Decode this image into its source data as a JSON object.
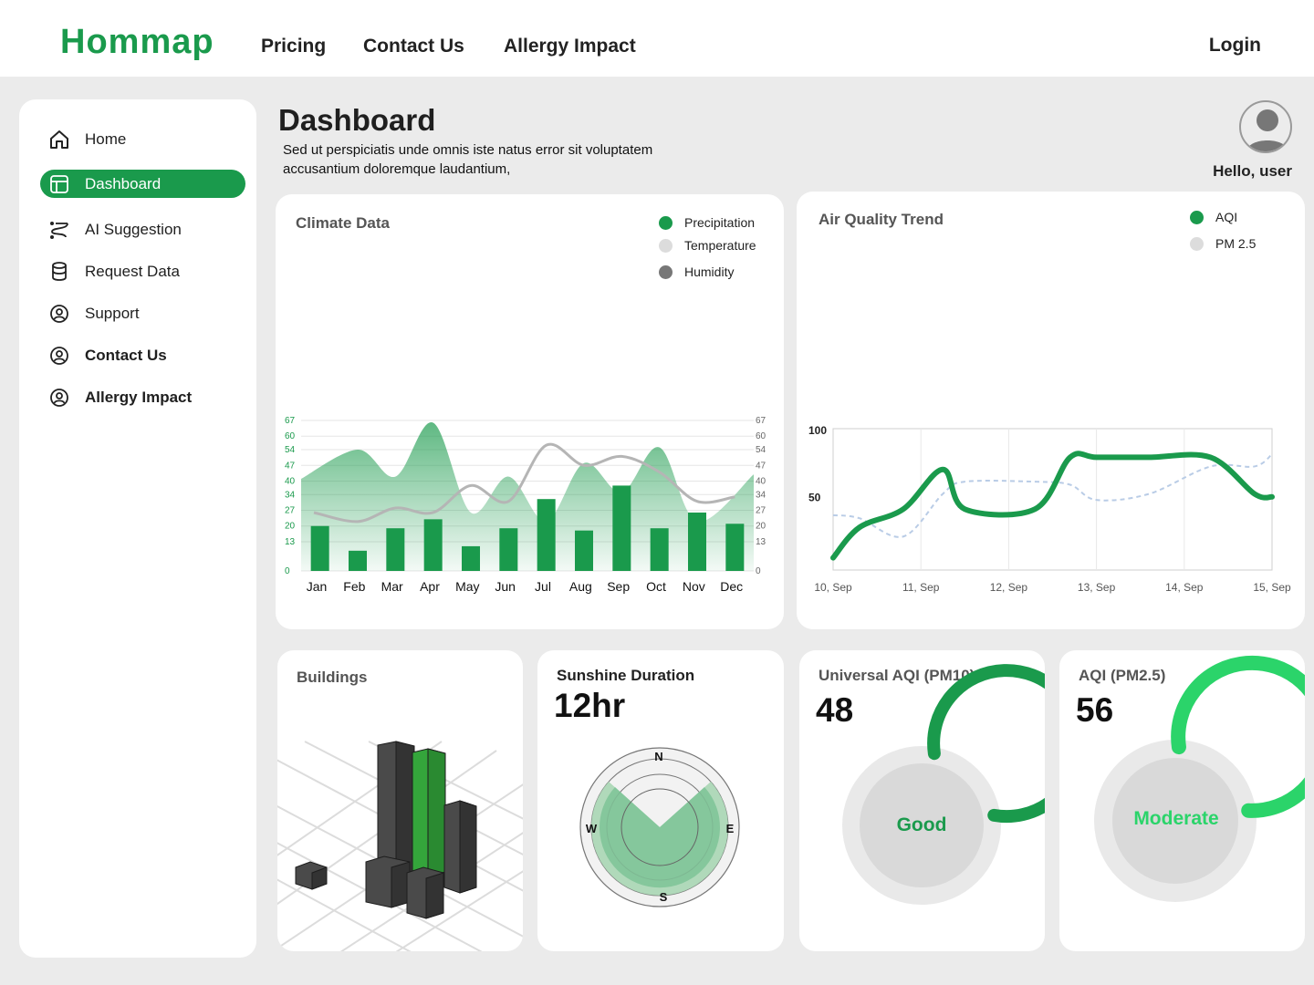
{
  "brand": {
    "name": "Hommap",
    "color": "#1a9a4c"
  },
  "nav": {
    "links": [
      "Pricing",
      "Contact Us",
      "Allergy Impact"
    ],
    "login": "Login"
  },
  "sidebar": {
    "items": [
      {
        "label": "Home",
        "icon": "home-icon",
        "active": false
      },
      {
        "label": "Dashboard",
        "icon": "dashboard-icon",
        "active": true
      },
      {
        "label": "AI Suggestion",
        "icon": "ai-route-icon",
        "active": false
      },
      {
        "label": "Request Data",
        "icon": "database-icon",
        "active": false
      },
      {
        "label": "Support",
        "icon": "support-icon",
        "active": false
      },
      {
        "label": "Contact Us",
        "icon": "contact-icon",
        "active": false
      },
      {
        "label": "Allergy Impact",
        "icon": "allergy-icon",
        "active": false
      }
    ]
  },
  "header": {
    "title": "Dashboard",
    "subtitle": "Sed ut perspiciatis unde omnis iste natus error sit voluptatem accusantium doloremque laudantium,",
    "greeting": "Hello,  user"
  },
  "climate": {
    "title": "Climate Data",
    "legend": [
      {
        "label": "Precipitation",
        "color": "#1a9a4c"
      },
      {
        "label": "Temperature",
        "color": "#dcdcdc"
      },
      {
        "label": "Humidity",
        "color": "#777777"
      }
    ]
  },
  "air_quality": {
    "title": "Air Quality Trend",
    "legend": [
      {
        "label": "AQI",
        "color": "#1a9a4c"
      },
      {
        "label": "PM 2.5",
        "color": "#dcdcdc"
      }
    ]
  },
  "buildings": {
    "title": "Buildings"
  },
  "sunshine": {
    "title": "Sunshine Duration",
    "value": "12hr",
    "directions": {
      "n": "N",
      "e": "E",
      "s": "S",
      "w": "W"
    }
  },
  "aqi_pm10": {
    "title": "Universal AQI (PM10)",
    "value": "48",
    "status": "Good",
    "fraction": 0.8,
    "color": "#1a9a4c"
  },
  "aqi_pm25": {
    "title": "AQI (PM2.5)",
    "value": "56",
    "status": "Moderate",
    "fraction": 0.78,
    "color": "#2bd46a"
  },
  "chart_data": [
    {
      "type": "bar",
      "title": "Climate Data",
      "categories": [
        "Jan",
        "Feb",
        "Mar",
        "Apr",
        "May",
        "Jun",
        "Jul",
        "Aug",
        "Sep",
        "Oct",
        "Nov",
        "Dec"
      ],
      "y_ticks_left": [
        "0",
        "13",
        "20",
        "27",
        "34",
        "40",
        "47",
        "54",
        "60",
        "67"
      ],
      "y_ticks_right": [
        "0",
        "13",
        "20",
        "27",
        "34",
        "40",
        "47",
        "54",
        "60",
        "67"
      ],
      "ylim": [
        0,
        67
      ],
      "series": [
        {
          "name": "Precipitation",
          "type": "bar",
          "color": "#1a9a4c",
          "values": [
            20,
            9,
            19,
            23,
            11,
            19,
            32,
            18,
            38,
            19,
            26,
            21
          ]
        },
        {
          "name": "Humidity",
          "type": "area",
          "color": "#1a9a4c",
          "values": [
            41,
            54,
            42,
            66,
            26,
            42,
            22,
            48,
            35,
            55,
            22,
            43
          ]
        },
        {
          "name": "Temperature",
          "type": "line",
          "color": "#b5b5b5",
          "values": [
            26,
            22,
            28,
            26,
            38,
            31,
            56,
            47,
            51,
            44,
            31,
            33
          ]
        }
      ],
      "grid": true
    },
    {
      "type": "line",
      "title": "Air Quality Trend",
      "categories": [
        "10, Sep",
        "11, Sep",
        "12, Sep",
        "13, Sep",
        "14, Sep",
        "15, Sep"
      ],
      "y_ticks": [
        "50",
        "100"
      ],
      "ylim": [
        0,
        100
      ],
      "series": [
        {
          "name": "AQI",
          "color": "#1a9a4c",
          "x": [
            0,
            0.3,
            0.8,
            1.25,
            1.5,
            2.3,
            2.7,
            3.0,
            3.6,
            4.3,
            4.8,
            5.0
          ],
          "y": [
            8,
            28,
            40,
            66,
            40,
            40,
            74,
            74,
            74,
            74,
            50,
            48
          ]
        },
        {
          "name": "PM 2.5",
          "color": "#b9cce6",
          "x": [
            0,
            0.3,
            0.8,
            1.25,
            1.5,
            2.3,
            2.7,
            3.0,
            3.6,
            4.3,
            4.8,
            5.0
          ],
          "y": [
            36,
            34,
            22,
            50,
            58,
            58,
            56,
            46,
            50,
            68,
            68,
            76
          ]
        }
      ],
      "grid": true
    }
  ]
}
